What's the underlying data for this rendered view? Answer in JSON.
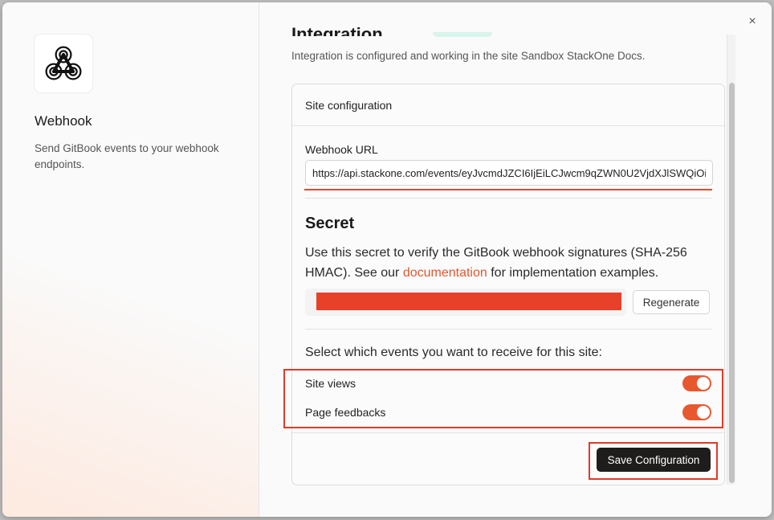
{
  "app": {
    "name": "Webhook",
    "description": "Send GitBook events to your webhook endpoints.",
    "logo_icon": "webhook-icon"
  },
  "dialog": {
    "close_icon": "close-icon",
    "close_glyph": "×"
  },
  "header": {
    "heading_partial": "Integration",
    "status_text": "Integration is configured and working in the site Sandbox StackOne Docs."
  },
  "card": {
    "title": "Site configuration",
    "webhook_url_label": "Webhook URL",
    "webhook_url_value": "https://api.stackone.com/events/eyJvcmdJZCI6IjEiLCJwcm9qZWN0U2VjdXJlSWQiOiIx",
    "secret": {
      "title": "Secret",
      "desc_before": "Use this secret to verify the GitBook webhook signatures (SHA-256 HMAC). See our ",
      "link_text": "documentation",
      "desc_after": " for implementation examples.",
      "regenerate_label": "Regenerate"
    },
    "events_prompt": "Select which events you want to receive for this site:",
    "events": [
      {
        "label": "Site views",
        "enabled": true
      },
      {
        "label": "Page feedbacks",
        "enabled": true
      }
    ],
    "save_label": "Save Configuration"
  },
  "colors": {
    "accent": "#e8582f",
    "link": "#e4572e",
    "annotation_red": "#e03a28",
    "button_dark": "#1f1d1b"
  }
}
